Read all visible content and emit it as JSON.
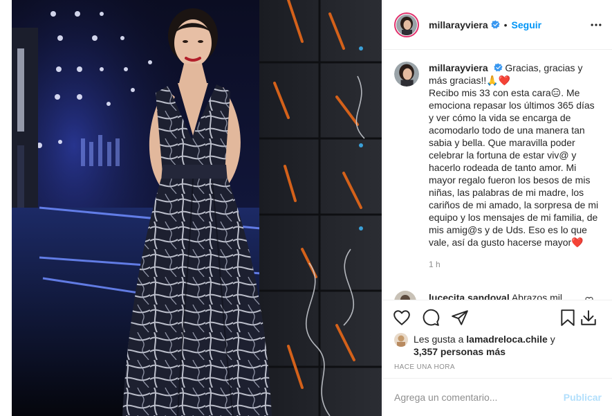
{
  "post": {
    "author": "millarayviera",
    "follow_label": "Seguir",
    "separator": "•",
    "caption_author": "millarayviera",
    "caption": "Gracias, gracias y más gracias!!🙏❤️\nRecibo mis 33 con esta cara😑. Me emociona repasar los últimos 365 días y ver cómo la vida se encarga de acomodarlo todo de una manera tan sabia y bella. Que maravilla poder celebrar la fortuna de estar viv@ y hacerlo rodeada de tanto amor. Mi mayor regalo fueron los besos de mis niñas, las palabras de mi madre, los cariños de mi amado, la sorpresa de mi equipo y los mensajes de mi familia, de mis amig@s y de Uds. Eso es lo que vale, así da gusto hacerse mayor❤️",
    "caption_time": "1 h"
  },
  "comment": {
    "user": "lucecita.sandoval",
    "text": "Abrazos mil"
  },
  "likes": {
    "prefix": "Les gusta a",
    "user": "lamadreloca.chile",
    "connector": "y",
    "count_text": "3,357 personas más"
  },
  "timestamp": "Hace una hora",
  "add_comment": {
    "placeholder": "Agrega un comentario...",
    "publish_label": "Publicar"
  },
  "icons": {
    "verified": "verified-badge-icon",
    "more": "more-options-icon",
    "like": "heart-outline-icon",
    "comment": "comment-bubble-icon",
    "share": "paper-plane-icon",
    "save": "bookmark-icon",
    "download": "download-icon"
  },
  "colors": {
    "link": "#0095f6",
    "publish_disabled": "#b2dffc",
    "secondary_text": "#8e8e8e",
    "heart": "#ed4956",
    "verified": "#3897f0"
  }
}
